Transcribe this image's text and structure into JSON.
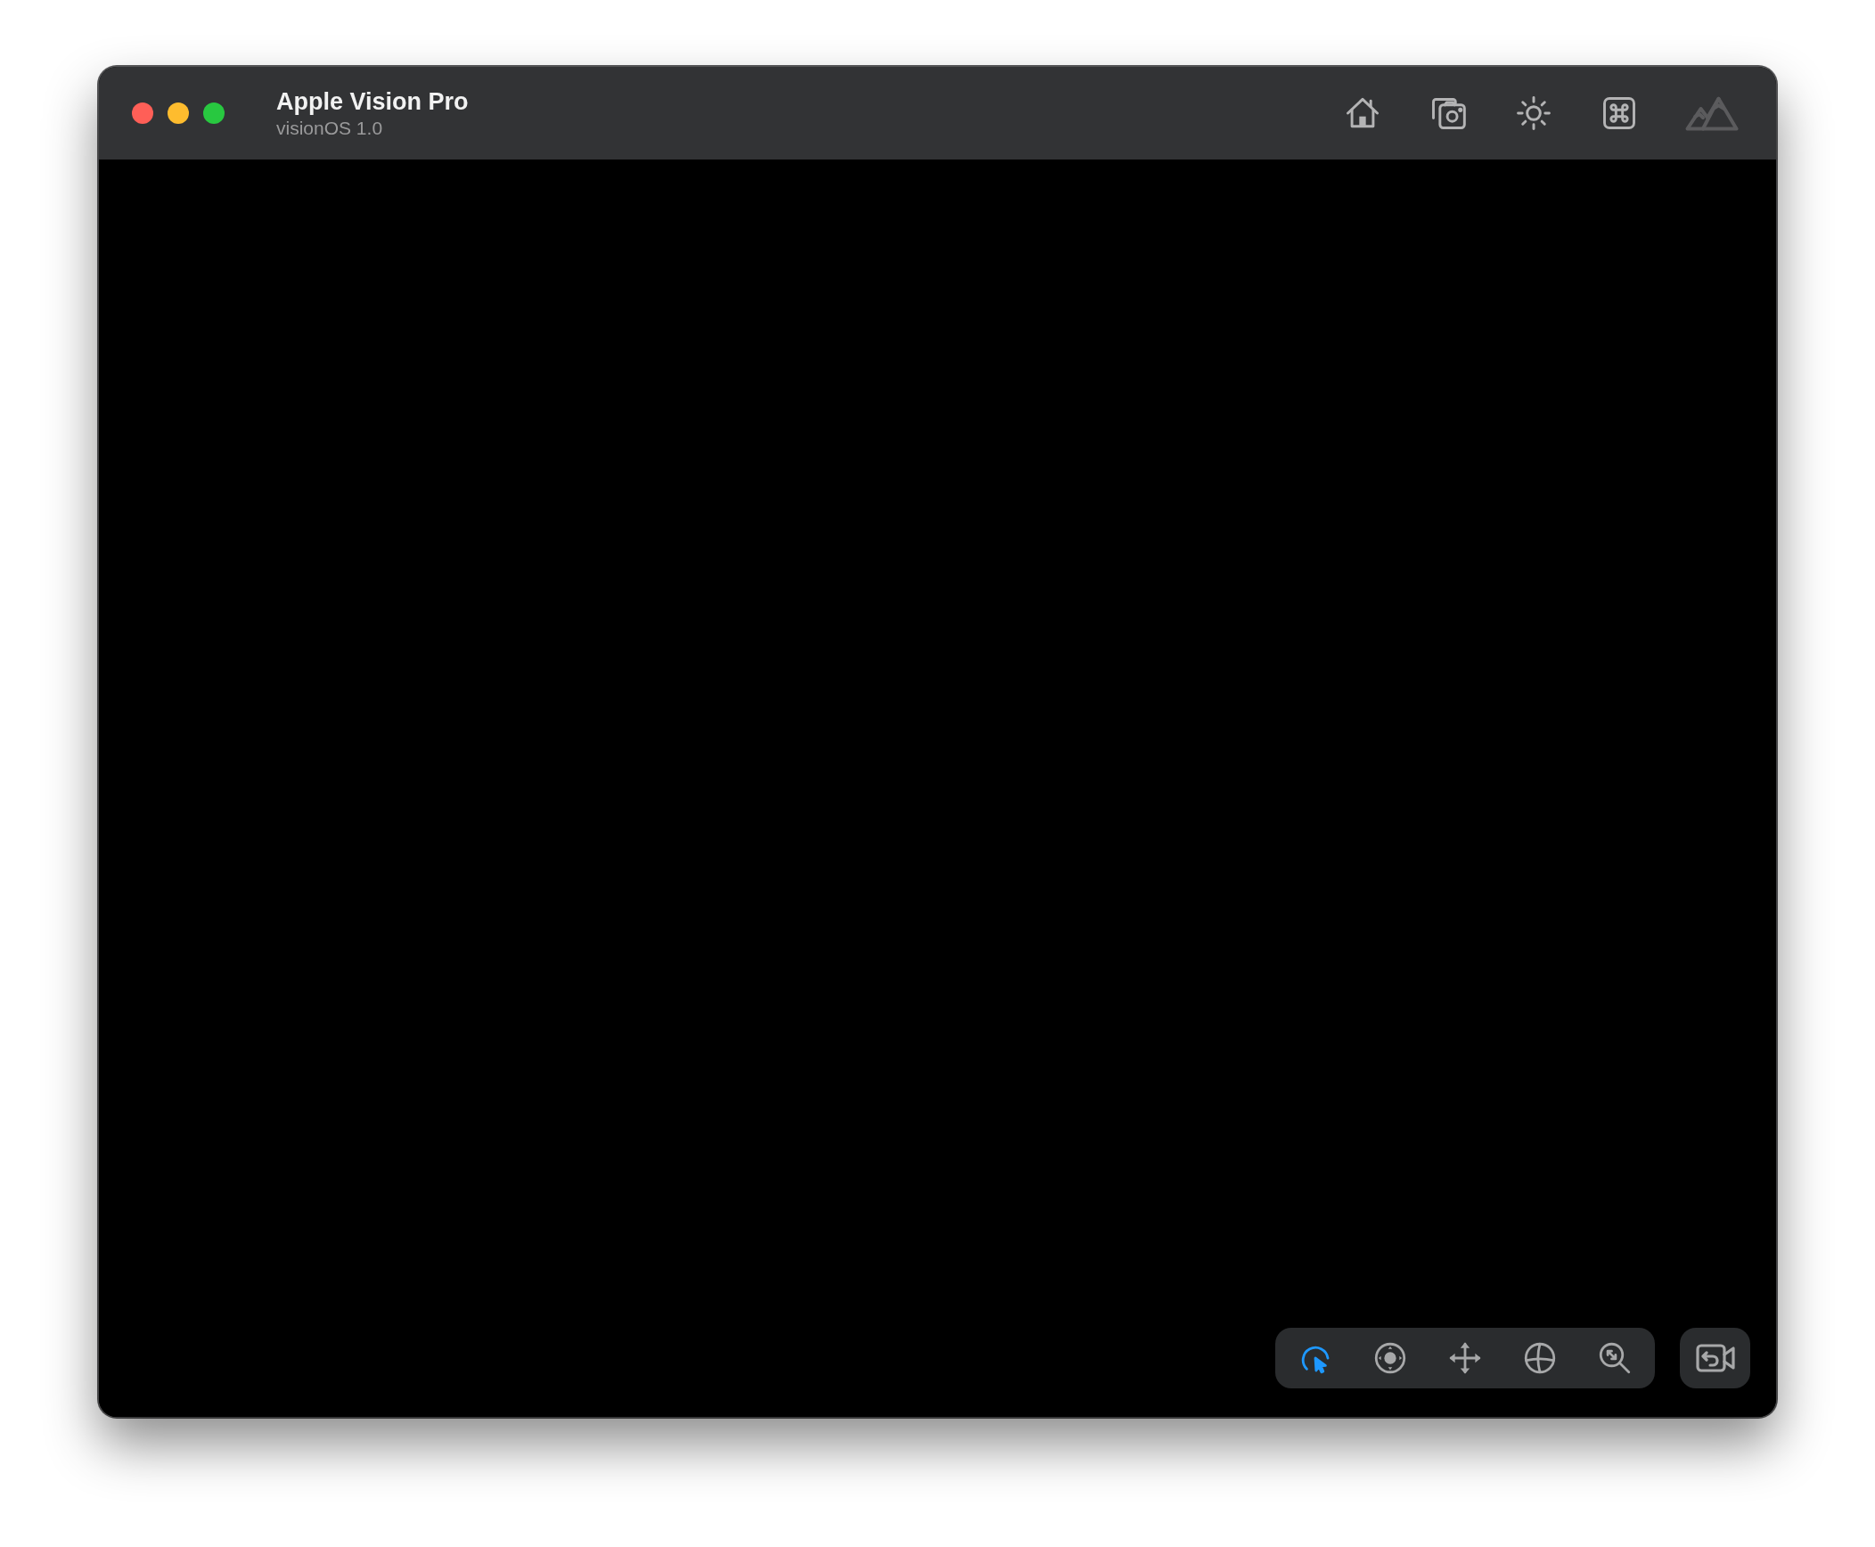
{
  "window": {
    "title": "Apple Vision Pro",
    "subtitle": "visionOS 1.0"
  },
  "title_bar_buttons": [
    {
      "kind": "home",
      "disabled": false
    },
    {
      "kind": "screenshot",
      "disabled": false
    },
    {
      "kind": "lighting",
      "disabled": false
    },
    {
      "kind": "keyboard",
      "disabled": false
    },
    {
      "kind": "environment",
      "disabled": true
    }
  ],
  "interaction_tools": [
    {
      "kind": "select",
      "selected": true
    },
    {
      "kind": "look",
      "selected": false
    },
    {
      "kind": "pan",
      "selected": false
    },
    {
      "kind": "orbit",
      "selected": false
    },
    {
      "kind": "zoom",
      "selected": false
    }
  ],
  "camera_reset": {
    "kind": "reset-camera"
  }
}
